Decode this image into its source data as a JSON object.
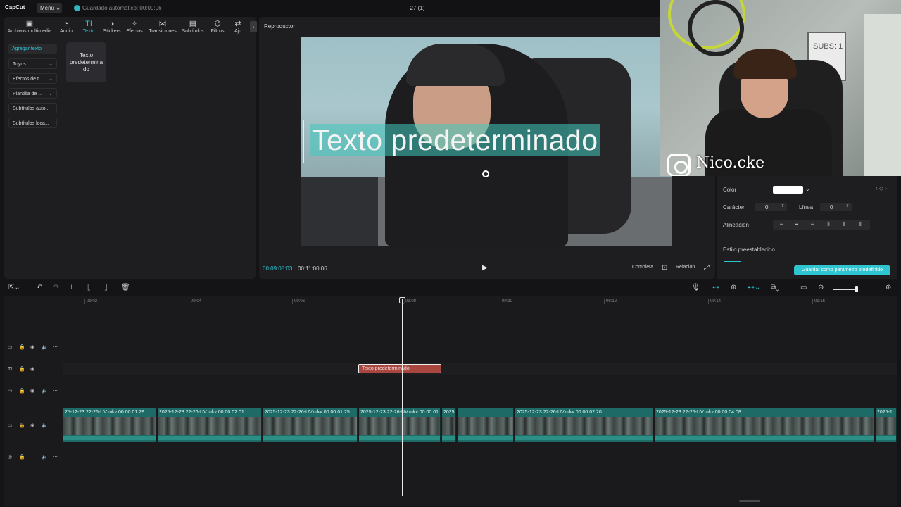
{
  "app": {
    "logo": "CapCut",
    "menu_label": "Menú",
    "autosave": "Guardado automático: 00:09:06",
    "project_title": "27 (1)"
  },
  "toolbar_tabs": [
    {
      "label": "Archivos multimedia",
      "icon": "media-icon"
    },
    {
      "label": "Audio",
      "icon": "audio-icon"
    },
    {
      "label": "Texto",
      "icon": "text-icon",
      "active": true
    },
    {
      "label": "Stickers",
      "icon": "sticker-icon"
    },
    {
      "label": "Efectos",
      "icon": "effects-icon"
    },
    {
      "label": "Transiciones",
      "icon": "transitions-icon"
    },
    {
      "label": "Subtítulos",
      "icon": "subtitles-icon"
    },
    {
      "label": "Filtros",
      "icon": "filters-icon"
    },
    {
      "label": "Aju",
      "icon": "adjust-icon"
    }
  ],
  "text_categories": [
    {
      "label": "Agregar texto",
      "active": true
    },
    {
      "label": "Tuyos",
      "chevron": true
    },
    {
      "label": "Efectos de t...",
      "chevron": true
    },
    {
      "label": "Plantilla de ...",
      "chevron": true
    },
    {
      "label": "Subtítulos auto..."
    },
    {
      "label": "Subtítulos loca..."
    }
  ],
  "preset_card": {
    "line1": "Texto",
    "line2": "predetermina",
    "line3": "do"
  },
  "player": {
    "title": "Reproductor",
    "overlay_text": "Texto predeterminado",
    "current_time": "00:09:08:03",
    "total_time": "00:11:00:06",
    "full_label": "Completa",
    "ratio_label": "Relación"
  },
  "webcam": {
    "instagram_handle": "Nico.cke",
    "board_text": "SUBS: 1"
  },
  "properties": {
    "color_label": "Color",
    "color_value": "#ffffff",
    "character_label": "Carácter",
    "character_value": "0",
    "line_label": "Línea",
    "line_value": "0",
    "alignment_label": "Alineación",
    "preset_style_label": "Estilo preestablecido",
    "save_preset_label": "Guardar como parámetro predefinido"
  },
  "ruler": [
    "09:02",
    "09:04",
    "09:06",
    "09:08",
    "09:10",
    "09:12",
    "09:14",
    "09:16"
  ],
  "text_clip_label": "Texto predeterminado",
  "video_clips": [
    {
      "label": "25-12-23 22-26-UV.mkv   00:00:01:29"
    },
    {
      "label": "2025-12-23 22-26-UV.mkv   00:00:02:01"
    },
    {
      "label": "2025-12-23 22-26-UV.mkv   00:00:01:25"
    },
    {
      "label": "2025-12-23 22-26-UV.mkv   00:00:01"
    },
    {
      "label": "2025"
    },
    {
      "label": "2025-12-23 22-26-UV.mkv   00:00:02:20"
    },
    {
      "label": "2025-12-23 22-26-UV.mkv   00:00:04:08"
    },
    {
      "label": "2025-1"
    }
  ],
  "colors": {
    "accent": "#2ec4d0",
    "text_clip": "#a8463f",
    "video_clip": "#1d6a66"
  }
}
